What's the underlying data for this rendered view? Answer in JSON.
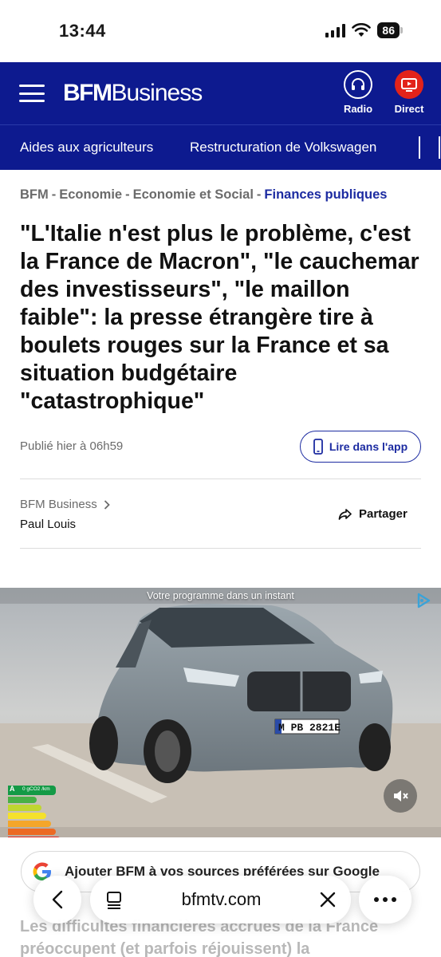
{
  "status_bar": {
    "time": "13:44",
    "battery": "86"
  },
  "header": {
    "logo_bold": "BFM",
    "logo_light": "Business",
    "radio_label": "Radio",
    "direct_label": "Direct",
    "brand_color": "#0d1a8f"
  },
  "category_nav": {
    "items": [
      "Aides aux agriculteurs",
      "Restructuration de Volkswagen"
    ]
  },
  "breadcrumb": {
    "items": [
      "BFM",
      "Economie",
      "Economie et Social"
    ],
    "current": "Finances publiques",
    "separator": "-"
  },
  "article": {
    "title": "\"L'Italie n'est plus le problème, c'est la France de Macron\", \"le cauchemar des investisseurs\", \"le maillon faible\": la presse étrangère tire à boulets rouges sur la France et sa situation budgétaire \"catastrophique\"",
    "published": "Publié hier à 06h59",
    "app_button": "Lire dans l'app",
    "source": "BFM Business",
    "author": "Paul Louis",
    "share_label": "Partager",
    "lead_text": "Les difficultés financières accrues de la France préoccupent (et parfois réjouissent) la"
  },
  "video": {
    "label": "Votre programme dans un instant",
    "plate": "M PB 2821E",
    "energy_label": "0 gCO2 /km"
  },
  "google_prompt": {
    "text": "Ajouter BFM à vos sources préférées sur Google"
  },
  "browser": {
    "url": "bfmtv.com"
  }
}
